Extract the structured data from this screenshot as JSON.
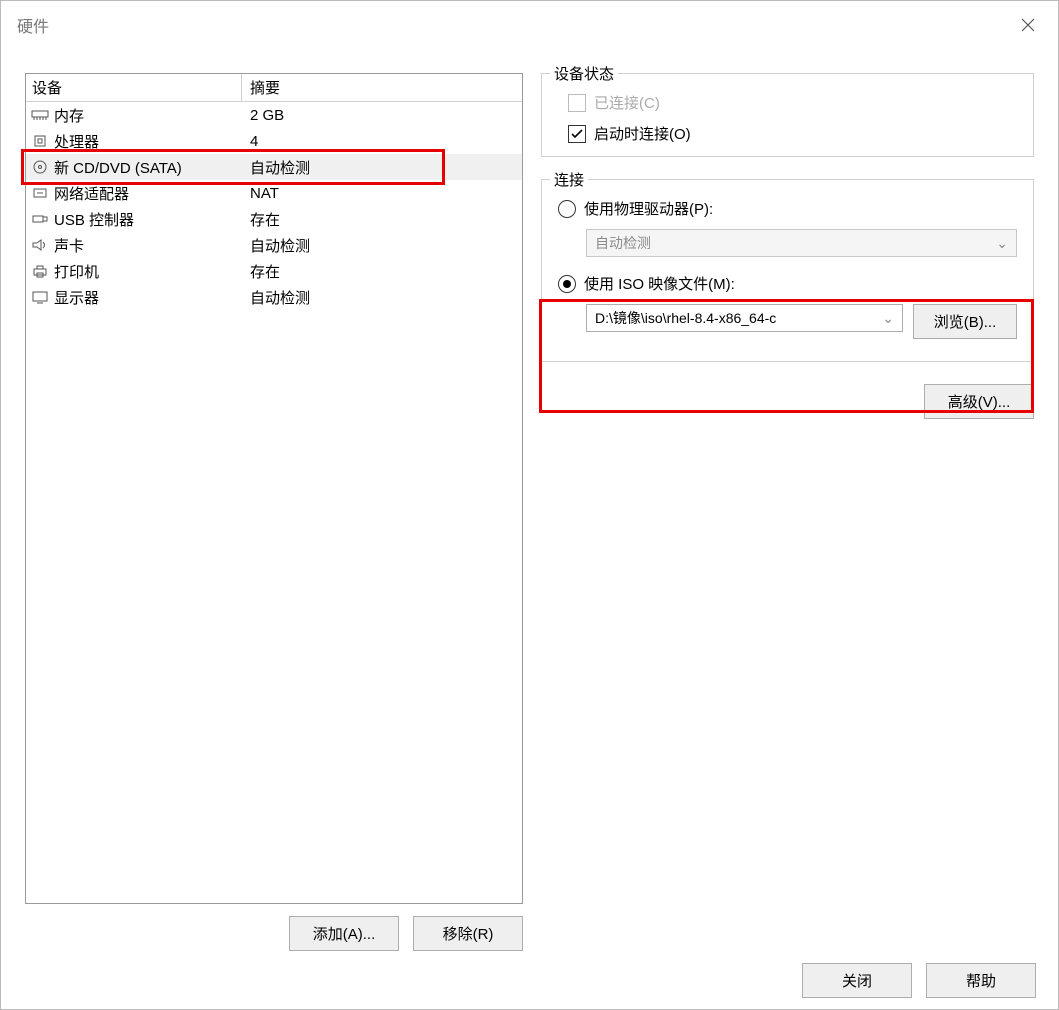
{
  "window": {
    "title": "硬件"
  },
  "deviceList": {
    "headers": {
      "device": "设备",
      "summary": "摘要"
    },
    "rows": [
      {
        "name": "内存",
        "summary": "2 GB",
        "icon": "memory"
      },
      {
        "name": "处理器",
        "summary": "4",
        "icon": "cpu"
      },
      {
        "name": "新 CD/DVD (SATA)",
        "summary": "自动检测",
        "icon": "disc",
        "selected": true
      },
      {
        "name": "网络适配器",
        "summary": "NAT",
        "icon": "net"
      },
      {
        "name": "USB 控制器",
        "summary": "存在",
        "icon": "usb"
      },
      {
        "name": "声卡",
        "summary": "自动检测",
        "icon": "sound"
      },
      {
        "name": "打印机",
        "summary": "存在",
        "icon": "printer"
      },
      {
        "name": "显示器",
        "summary": "自动检测",
        "icon": "display"
      }
    ]
  },
  "buttons": {
    "add": "添加(A)...",
    "remove": "移除(R)",
    "browse": "浏览(B)...",
    "advanced": "高级(V)...",
    "close": "关闭",
    "help": "帮助"
  },
  "deviceStatus": {
    "legend": "设备状态",
    "connected": {
      "label": "已连接(C)",
      "checked": false,
      "disabled": true
    },
    "connectAtPowerOn": {
      "label": "启动时连接(O)",
      "checked": true,
      "disabled": false
    }
  },
  "connection": {
    "legend": "连接",
    "usePhysical": {
      "label": "使用物理驱动器(P):",
      "selected": false
    },
    "physicalCombo": {
      "value": "自动检测",
      "disabled": true
    },
    "useIso": {
      "label": "使用 ISO 映像文件(M):",
      "selected": true
    },
    "isoCombo": {
      "value": "D:\\镜像\\iso\\rhel-8.4-x86_64-c"
    }
  }
}
